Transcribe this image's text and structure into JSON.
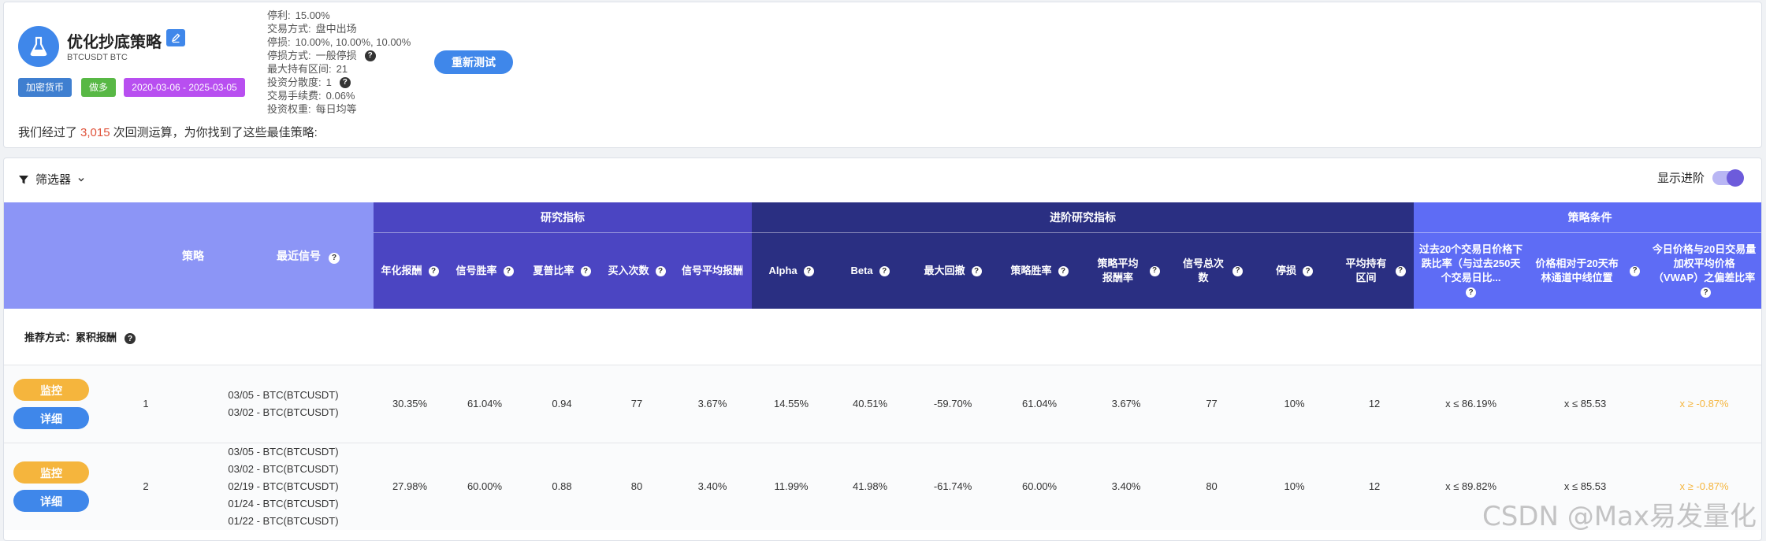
{
  "strategy": {
    "title": "优化抄底策略",
    "subtitle": "BTCUSDT BTC",
    "tags": {
      "market": "加密货币",
      "direction": "做多",
      "date_range": "2020-03-06 - 2025-03-05"
    },
    "colors": {
      "market": "#3f7fd0",
      "direction": "#58b845",
      "date_range": "#b84ff0"
    },
    "params": [
      {
        "label": "停利:",
        "value": "15.00%",
        "help": false
      },
      {
        "label": "交易方式:",
        "value": "盘中出场",
        "help": false
      },
      {
        "label": "停损:",
        "value": "10.00%, 10.00%, 10.00%",
        "help": false
      },
      {
        "label": "停损方式:",
        "value": "一般停损",
        "help": true
      },
      {
        "label": "最大持有区间:",
        "value": "21",
        "help": false
      },
      {
        "label": "投资分散度:",
        "value": "1",
        "help": true
      },
      {
        "label": "交易手续费:",
        "value": "0.06%",
        "help": false
      },
      {
        "label": "投资权重:",
        "value": "每日均等",
        "help": false
      }
    ],
    "retest_label": "重新测试",
    "summary": {
      "prefix": "我们经过了",
      "count": "3,015",
      "suffix": "次回测运算，为你找到了这些最佳策略:"
    }
  },
  "toolbar": {
    "filter_label": "筛选器",
    "toggle_label": "显示进阶",
    "toggle_on": true
  },
  "table": {
    "groups": {
      "research": "研究指标",
      "advanced": "进阶研究指标",
      "conditions": "策略条件"
    },
    "headers": {
      "strategy": "策略",
      "recent_signal": "最近信号",
      "annual_return": "年化报酬",
      "signal_winrate": "信号胜率",
      "sharpe": "夏普比率",
      "buy_count": "买入次数",
      "signal_avg_return": "信号平均报酬",
      "alpha": "Alpha",
      "beta": "Beta",
      "max_drawdown": "最大回撤",
      "strategy_winrate": "策略胜率",
      "strategy_avg_return": "策略平均报酬率",
      "signal_total": "信号总次数",
      "stop_loss": "停损",
      "avg_hold": "平均持有区间",
      "cond1": "过去20个交易日价格下跌比率（与过去250天个交易日比...",
      "cond2": "价格相对于20天布林通道中线位置",
      "cond3": "今日价格与20日交易量加权平均价格（VWAP）之偏差比率"
    },
    "recommend_label": "推荐方式：累积报酬",
    "help_glyph": "?",
    "row_buttons": {
      "monitor": "监控",
      "detail": "详细"
    },
    "rows": [
      {
        "rank": "1",
        "signals": [
          "03/05 - BTC(BTCUSDT)",
          "03/02 - BTC(BTCUSDT)"
        ],
        "annual_return": "30.35%",
        "signal_winrate": "61.04%",
        "sharpe": "0.94",
        "buy_count": "77",
        "signal_avg_return": "3.67%",
        "alpha": "14.55%",
        "beta": "40.51%",
        "max_drawdown": "-59.70%",
        "strategy_winrate": "61.04%",
        "strategy_avg_return": "3.67%",
        "signal_total": "77",
        "stop_loss": "10%",
        "avg_hold": "12",
        "cond1": "x ≤ 86.19%",
        "cond2": "x ≤ 85.53",
        "cond3": "x ≥ -0.87%"
      },
      {
        "rank": "2",
        "signals": [
          "03/05 - BTC(BTCUSDT)",
          "03/02 - BTC(BTCUSDT)",
          "02/19 - BTC(BTCUSDT)",
          "01/24 - BTC(BTCUSDT)",
          "01/22 - BTC(BTCUSDT)"
        ],
        "annual_return": "27.98%",
        "signal_winrate": "60.00%",
        "sharpe": "0.88",
        "buy_count": "80",
        "signal_avg_return": "3.40%",
        "alpha": "11.99%",
        "beta": "41.98%",
        "max_drawdown": "-61.74%",
        "strategy_winrate": "60.00%",
        "strategy_avg_return": "3.40%",
        "signal_total": "80",
        "stop_loss": "10%",
        "avg_hold": "12",
        "cond1": "x ≤ 89.82%",
        "cond2": "x ≤ 85.53",
        "cond3": "x ≥ -0.87%"
      }
    ]
  },
  "watermark": "CSDN @Max易发量化"
}
